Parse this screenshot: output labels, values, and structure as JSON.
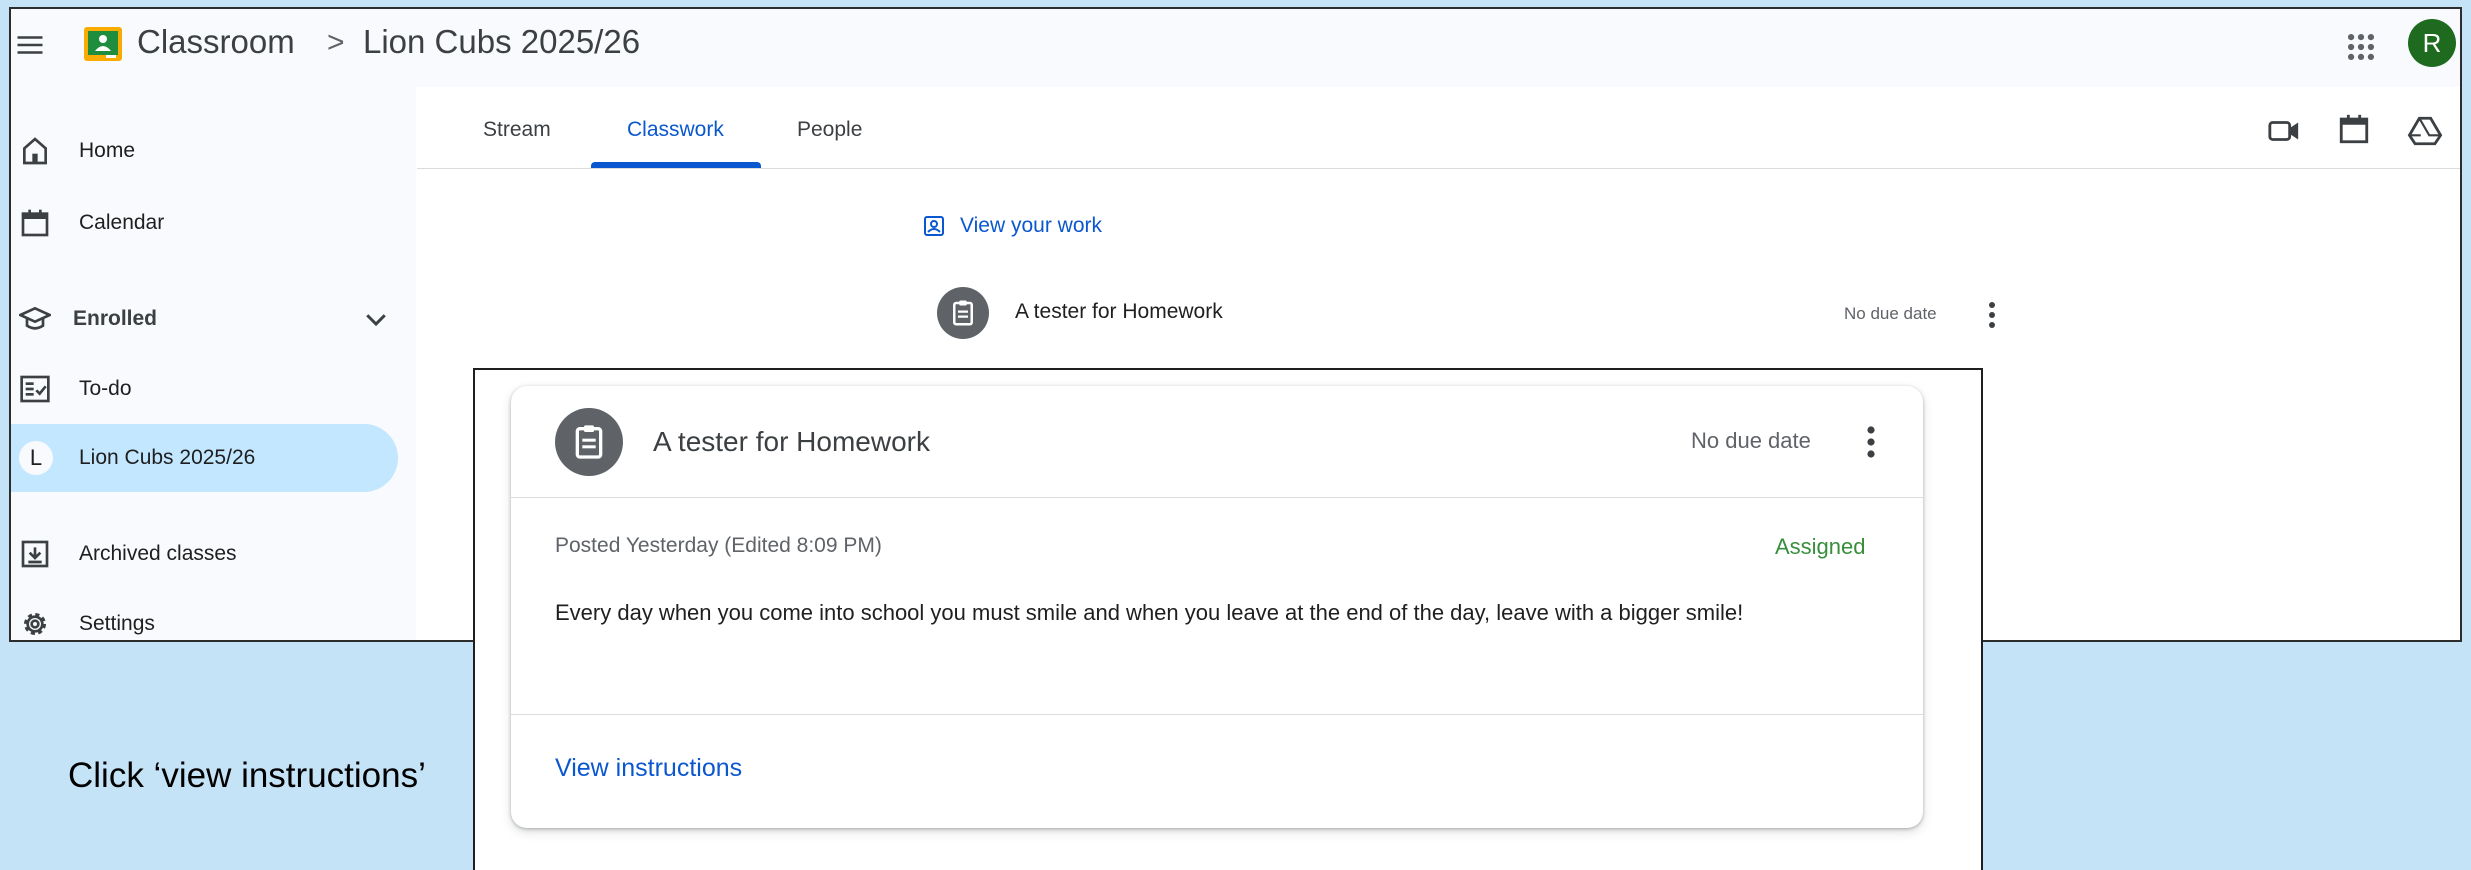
{
  "topbar": {
    "app_title": "Classroom",
    "breadcrumb_separator": ">",
    "class_title": "Lion Cubs 2025/26",
    "avatar_initial": "R",
    "icons": [
      "menu-icon",
      "classroom-logo",
      "apps-grid-icon",
      "avatar"
    ]
  },
  "sidebar": {
    "items": [
      {
        "label": "Home",
        "icon": "home-icon"
      },
      {
        "label": "Calendar",
        "icon": "calendar-icon"
      },
      {
        "label": "Enrolled",
        "icon": "graduation-cap-icon"
      },
      {
        "label": "To-do",
        "icon": "todo-icon"
      },
      {
        "label": "Lion Cubs 2025/26",
        "icon": "class-letter",
        "letter": "L",
        "selected": true
      },
      {
        "label": "Archived classes",
        "icon": "archive-icon"
      },
      {
        "label": "Settings",
        "icon": "gear-icon"
      }
    ]
  },
  "tabs": {
    "items": [
      {
        "label": "Stream"
      },
      {
        "label": "Classwork",
        "active": true
      },
      {
        "label": "People"
      }
    ],
    "right_icons": [
      "meet-video-icon",
      "calendar-icon",
      "drive-icon"
    ]
  },
  "classwork": {
    "view_work_label": "View your work",
    "assignment": {
      "title": "A tester for Homework",
      "due": "No due date"
    }
  },
  "popup": {
    "title": "A tester for Homework",
    "due": "No due date",
    "posted": "Posted Yesterday (Edited 8:09 PM)",
    "status": "Assigned",
    "description": "Every day when you come into school you must smile and when you leave at the end of the day, leave with a bigger smile!",
    "link_label": "View instructions"
  },
  "caption": "Click ‘view instructions’",
  "colors": {
    "accent_blue": "#0b57d0",
    "selected_bg": "#c2e7ff",
    "status_green": "#388e3c",
    "avatar_bg": "#1e6b20",
    "slide_bg": "#c5e3f7"
  }
}
